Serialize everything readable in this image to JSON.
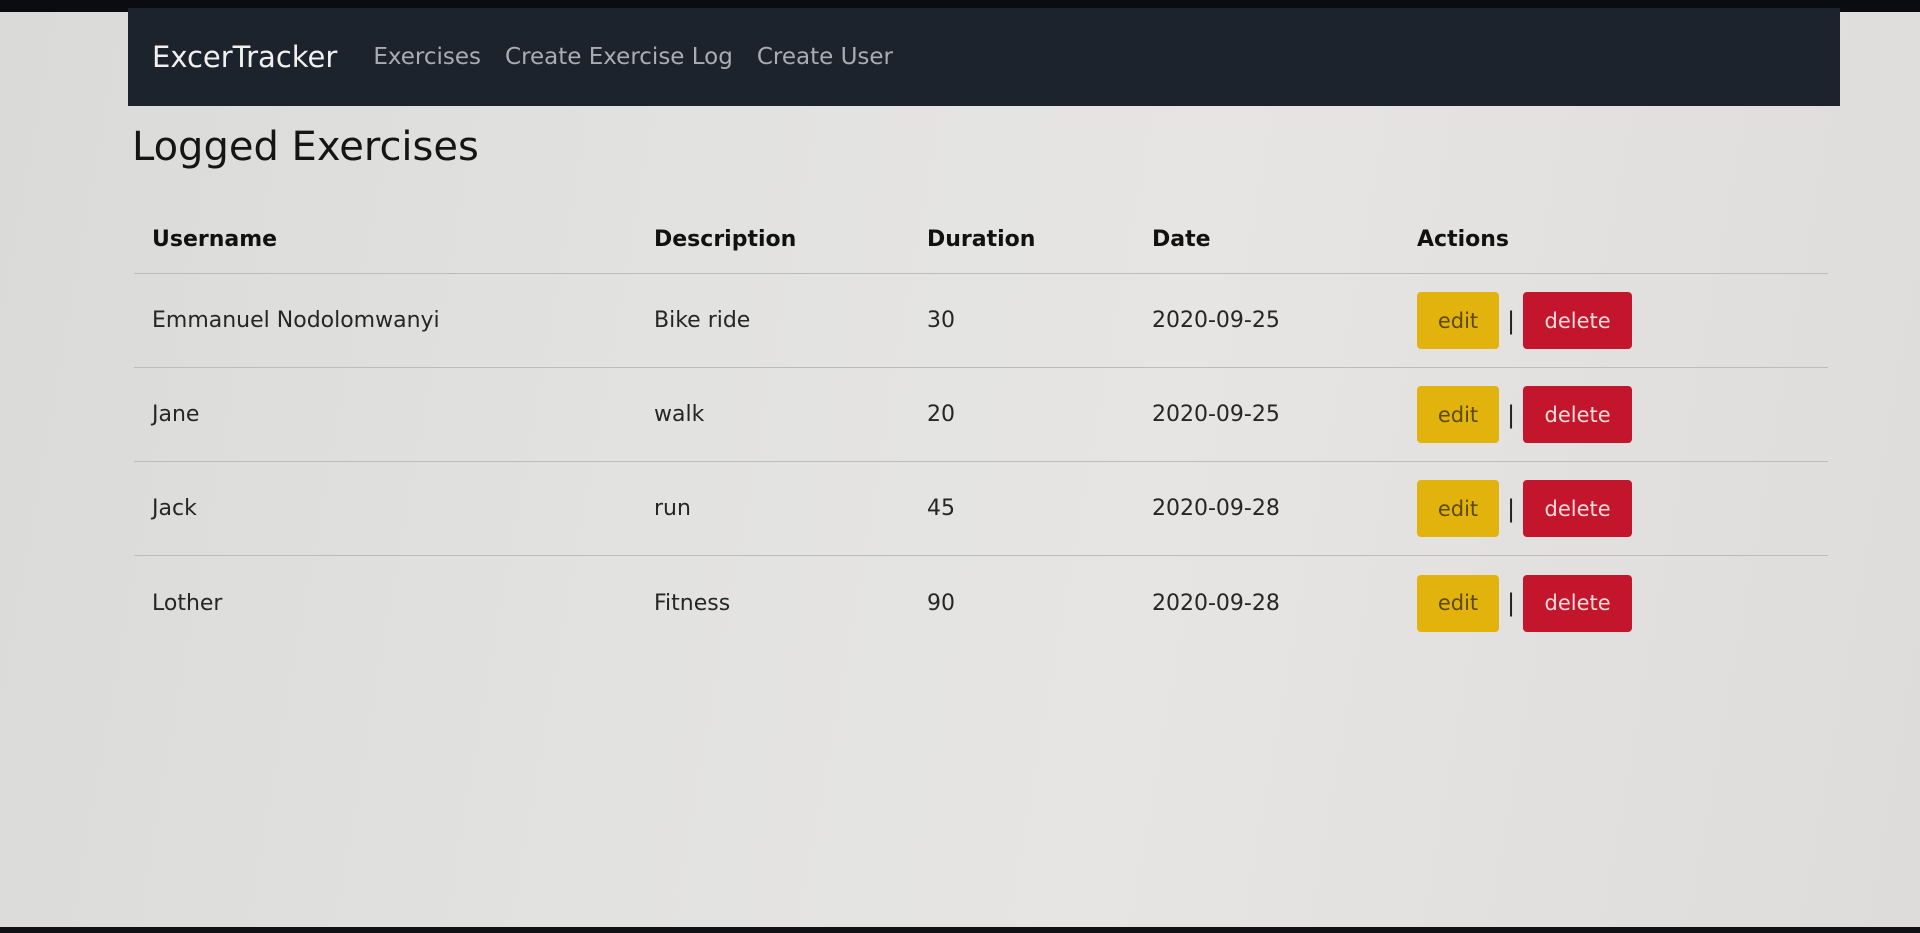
{
  "navbar": {
    "brand": "ExcerTracker",
    "links": [
      "Exercises",
      "Create Exercise Log",
      "Create User"
    ]
  },
  "page_title": "Logged Exercises",
  "table": {
    "headers": [
      "Username",
      "Description",
      "Duration",
      "Date",
      "Actions"
    ],
    "rows": [
      {
        "username": "Emmanuel Nodolomwanyi",
        "description": "Bike ride",
        "duration": "30",
        "date": "2020-09-25"
      },
      {
        "username": "Jane",
        "description": "walk",
        "duration": "20",
        "date": "2020-09-25"
      },
      {
        "username": "Jack",
        "description": "run",
        "duration": "45",
        "date": "2020-09-28"
      },
      {
        "username": "Lother",
        "description": "Fitness",
        "duration": "90",
        "date": "2020-09-28"
      }
    ],
    "actions": {
      "edit_label": "edit",
      "separator": "|",
      "delete_label": "delete"
    }
  },
  "colors": {
    "navbar_bg": "#1d232c",
    "edit_button": "#e2b30c",
    "delete_button": "#c3162c"
  }
}
